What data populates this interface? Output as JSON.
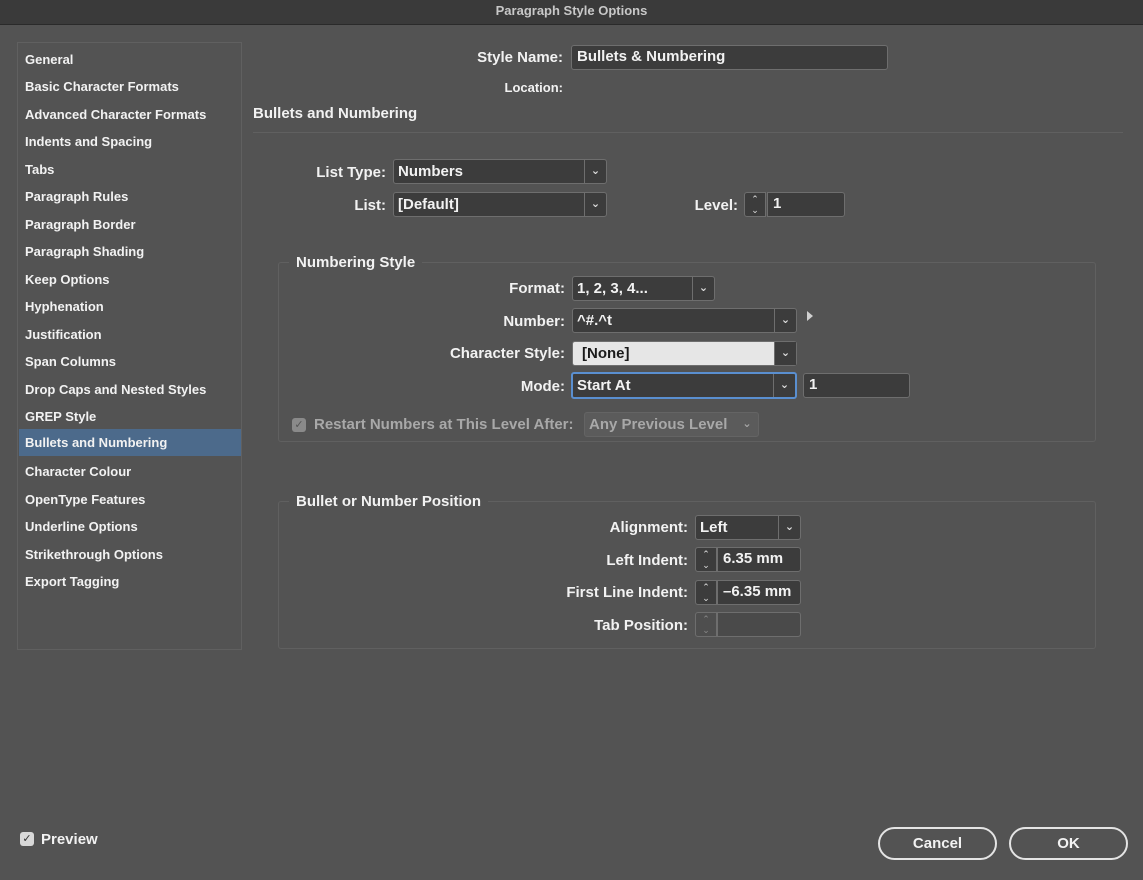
{
  "window": {
    "title": "Paragraph Style Options"
  },
  "sidebar": {
    "items": [
      {
        "label": "General"
      },
      {
        "label": "Basic Character Formats"
      },
      {
        "label": "Advanced Character Formats"
      },
      {
        "label": "Indents and Spacing"
      },
      {
        "label": "Tabs"
      },
      {
        "label": "Paragraph Rules"
      },
      {
        "label": "Paragraph Border"
      },
      {
        "label": "Paragraph Shading"
      },
      {
        "label": "Keep Options"
      },
      {
        "label": "Hyphenation"
      },
      {
        "label": "Justification"
      },
      {
        "label": "Span Columns"
      },
      {
        "label": "Drop Caps and Nested Styles"
      },
      {
        "label": "GREP Style"
      },
      {
        "label": "Bullets and Numbering"
      },
      {
        "label": "Character Colour"
      },
      {
        "label": "OpenType Features"
      },
      {
        "label": "Underline Options"
      },
      {
        "label": "Strikethrough Options"
      },
      {
        "label": "Export Tagging"
      }
    ],
    "selected": "Bullets and Numbering"
  },
  "header": {
    "style_name_label": "Style Name:",
    "style_name_value": "Bullets & Numbering",
    "location_label": "Location:",
    "section_title": "Bullets and Numbering"
  },
  "list": {
    "list_type_label": "List Type:",
    "list_type_value": "Numbers",
    "list_label": "List:",
    "list_value": "[Default]",
    "level_label": "Level:",
    "level_value": "1"
  },
  "numbering_style": {
    "title": "Numbering Style",
    "format_label": "Format:",
    "format_value": "1, 2, 3, 4...",
    "number_label": "Number:",
    "number_value": "^#.^t",
    "char_style_label": "Character Style:",
    "char_style_value": "[None]",
    "mode_label": "Mode:",
    "mode_value": "Start At",
    "start_at_value": "1",
    "restart_label": "Restart Numbers at This Level After:",
    "restart_checked": true,
    "restart_value": "Any Previous Level"
  },
  "position": {
    "title": "Bullet or Number Position",
    "alignment_label": "Alignment:",
    "alignment_value": "Left",
    "left_indent_label": "Left Indent:",
    "left_indent_value": "6.35 mm",
    "first_line_label": "First Line Indent:",
    "first_line_value": "–6.35 mm",
    "tab_position_label": "Tab Position:",
    "tab_position_value": ""
  },
  "footer": {
    "preview_label": "Preview",
    "preview_checked": true,
    "cancel_label": "Cancel",
    "ok_label": "OK"
  },
  "colors": {
    "background": "#535353",
    "selected_item": "#4c6a8b",
    "focus_ring": "#5a8fd0"
  },
  "icons": {
    "checkmark": "checkmark-icon",
    "dropdown": "chevron-down-icon",
    "spinner": "stepper-icon",
    "flyout": "triangle-right-icon"
  }
}
